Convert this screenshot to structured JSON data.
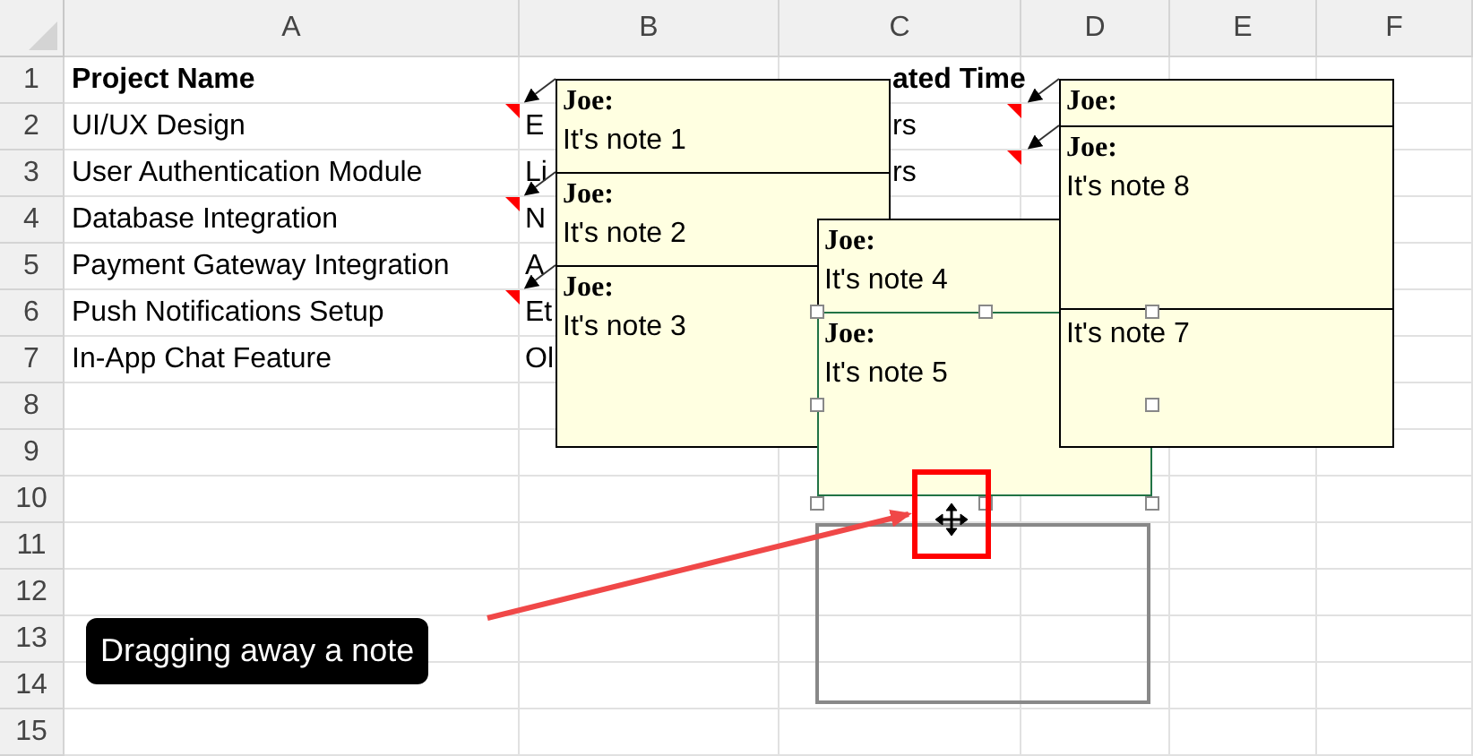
{
  "sheet": {
    "columns": [
      "A",
      "B",
      "C",
      "D",
      "E",
      "F"
    ],
    "row_numbers": [
      "1",
      "2",
      "3",
      "4",
      "5",
      "6",
      "7",
      "8",
      "9",
      "10",
      "11",
      "12",
      "13",
      "14",
      "15"
    ],
    "rows": [
      [
        "Project Name",
        "",
        "ated Time"
      ],
      [
        "UI/UX Design",
        "E",
        "rs"
      ],
      [
        "User Authentication Module",
        "Li",
        "rs"
      ],
      [
        "Database Integration",
        "N"
      ],
      [
        "Payment Gateway Integration",
        "A"
      ],
      [
        "Push Notifications Setup",
        "Et"
      ],
      [
        "In-App Chat Feature",
        "Ol"
      ]
    ]
  },
  "notes": [
    {
      "author": "Joe:",
      "text": "It's note 1",
      "selected": false
    },
    {
      "author": "Joe:",
      "text": "It's note 2",
      "selected": false
    },
    {
      "author": "Joe:",
      "text": "It's note 3",
      "selected": false
    },
    {
      "author": "Joe:",
      "text": "It's note 4",
      "selected": false
    },
    {
      "author": "Joe:",
      "text": "It's note 5",
      "selected": true
    },
    {
      "author": "Joe:",
      "selected": false
    },
    {
      "author": "Joe:",
      "text": "It's note 8",
      "selected": false
    },
    {
      "text": "It's note 7",
      "selected": false
    }
  ],
  "callout": {
    "text": "Dragging away a note"
  }
}
